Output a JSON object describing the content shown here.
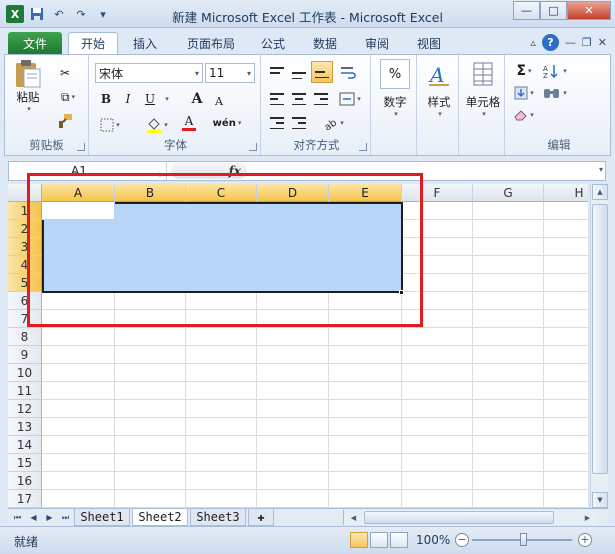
{
  "window": {
    "title": "新建 Microsoft Excel 工作表 - Microsoft Excel"
  },
  "tabs": [
    "文件",
    "开始",
    "插入",
    "页面布局",
    "公式",
    "数据",
    "审阅",
    "视图"
  ],
  "ribbon": {
    "clipboard": {
      "label": "剪贴板",
      "paste": "粘贴"
    },
    "font": {
      "label": "字体",
      "name": "宋体",
      "size": "11",
      "bold": "B",
      "italic": "I",
      "underline": "U",
      "grow": "A",
      "shrink": "A",
      "fontcolor": "A",
      "wen": "wén"
    },
    "alignment": {
      "label": "对齐方式"
    },
    "number": {
      "label": "数字",
      "percent": "%"
    },
    "styles": {
      "label": "样式"
    },
    "cells": {
      "label": "单元格"
    },
    "editing": {
      "label": "编辑",
      "sum": "Σ"
    }
  },
  "formula_bar": {
    "name_box": "A1",
    "fx": "fx"
  },
  "columns": [
    "A",
    "B",
    "C",
    "D",
    "E",
    "F",
    "G",
    "H"
  ],
  "rows": [
    "1",
    "2",
    "3",
    "4",
    "5",
    "6",
    "7",
    "8",
    "9",
    "10",
    "11",
    "12",
    "13",
    "14",
    "15",
    "16",
    "17"
  ],
  "sheets": [
    "Sheet1",
    "Sheet2",
    "Sheet3"
  ],
  "status": {
    "ready": "就绪",
    "zoom": "100%",
    "zoom_out": "−",
    "zoom_in": "+"
  },
  "colors": {
    "selection": "#b8d6f6",
    "highlight_box": "#e01b24",
    "file_tab": "#1f7a32"
  }
}
